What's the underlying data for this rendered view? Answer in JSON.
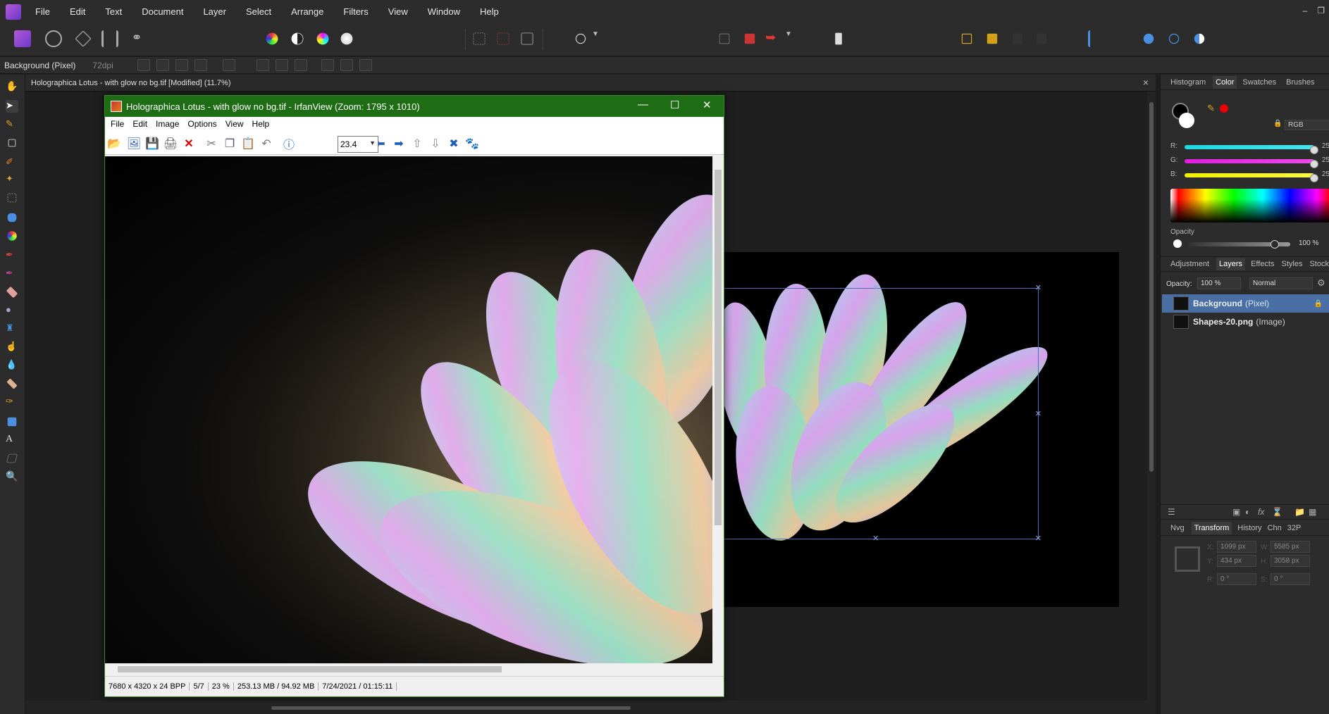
{
  "app": {
    "menu": [
      "File",
      "Edit",
      "Text",
      "Document",
      "Layer",
      "Select",
      "Arrange",
      "Filters",
      "View",
      "Window",
      "Help"
    ],
    "window_controls": [
      "–",
      "❐"
    ]
  },
  "context": {
    "layer_label": "Background (Pixel)",
    "dpi": "72dpi"
  },
  "document": {
    "tab_title": "Holographica Lotus - with glow no bg.tif [Modified] (11.7%)",
    "close": "×"
  },
  "right_panel": {
    "top_tabs": [
      "Histogram",
      "Color",
      "Swatches",
      "Brushes"
    ],
    "active_top_tab": "Color",
    "color_model": "RGB",
    "channels": [
      {
        "label": "R:",
        "value": "25",
        "color": "#33d6e0"
      },
      {
        "label": "G:",
        "value": "25",
        "color": "#e033e0"
      },
      {
        "label": "B:",
        "value": "25",
        "color": "#f0f000"
      }
    ],
    "opacity_label": "Opacity",
    "opacity_value": "100 %",
    "mid_tabs": [
      "Adjustment",
      "Layers",
      "Effects",
      "Styles",
      "Stock"
    ],
    "active_mid_tab": "Layers",
    "layers_opacity_label": "Opacity:",
    "layers_opacity": "100 %",
    "blend_mode": "Normal",
    "layers": [
      {
        "name": "Background",
        "type": "(Pixel)",
        "selected": true
      },
      {
        "name": "Shapes-20.png",
        "type": "(Image)",
        "selected": false
      }
    ],
    "bottom_tabs": [
      "Nvg",
      "Transform",
      "History",
      "Chn",
      "32P"
    ],
    "active_bottom_tab": "Transform",
    "transform": {
      "x_label": "X:",
      "x": "1099 px",
      "y_label": "Y:",
      "y": "434 px",
      "w_label": "W:",
      "w": "5585 px",
      "h_label": "H:",
      "h": "3058 px",
      "r_label": "R:",
      "r": "0 °",
      "s_label": "S:",
      "s": "0 °"
    }
  },
  "irfanview": {
    "title": "Holographica Lotus - with glow no bg.tif - IrfanView (Zoom: 1795 x 1010)",
    "menu": [
      "File",
      "Edit",
      "Image",
      "Options",
      "View",
      "Help"
    ],
    "zoom_value": "23.4",
    "status": [
      "7680 x 4320 x 24 BPP",
      "5/7",
      "23 %",
      "253.13 MB / 94.92 MB",
      "7/24/2021 / 01:15:11"
    ],
    "controls": {
      "minimize": "—",
      "maximize": "☐",
      "close": "✕"
    }
  }
}
